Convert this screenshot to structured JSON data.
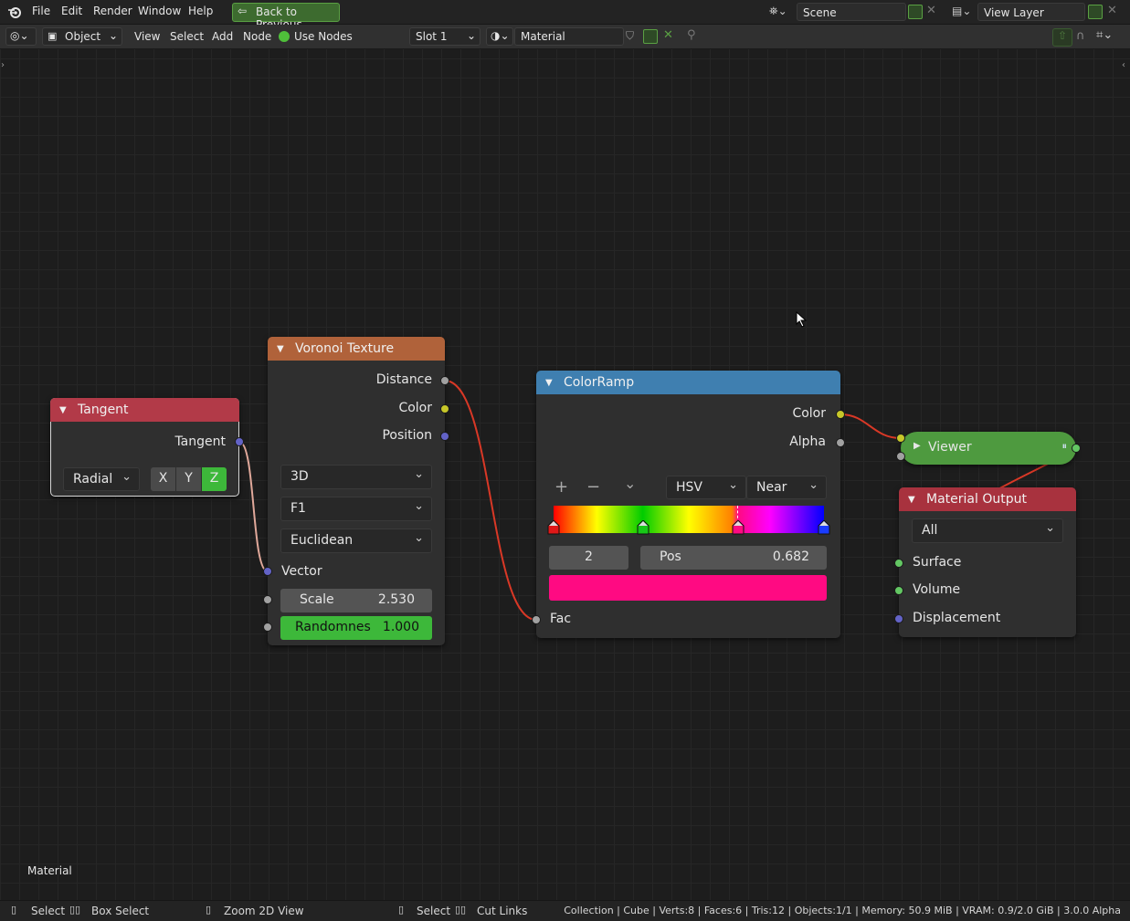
{
  "topbar": {
    "menus": [
      "File",
      "Edit",
      "Render",
      "Window",
      "Help"
    ],
    "back_button": "Back to Previous",
    "scene_field": "Scene",
    "view_layer_field": "View Layer"
  },
  "header": {
    "mode": "Object",
    "menus": [
      "View",
      "Select",
      "Add",
      "Node"
    ],
    "use_nodes": "Use Nodes",
    "slot": "Slot 1",
    "material": "Material"
  },
  "nodes": {
    "tangent": {
      "title": "Tangent",
      "output": "Tangent",
      "direction": "Radial",
      "axes": [
        "X",
        "Y",
        "Z"
      ],
      "active_axis": "Z"
    },
    "voronoi": {
      "title": "Voronoi Texture",
      "outputs": [
        "Distance",
        "Color",
        "Position"
      ],
      "dimension": "3D",
      "feature": "F1",
      "metric": "Euclidean",
      "vector_input": "Vector",
      "scale_label": "Scale",
      "scale_value": "2.530",
      "randomness_label": "Randomnes",
      "randomness_value": "1.000"
    },
    "colorramp": {
      "title": "ColorRamp",
      "outputs": [
        "Color",
        "Alpha"
      ],
      "add_btn": "+",
      "remove_btn": "−",
      "menu_btn": "⌄",
      "color_mode": "HSV",
      "interpolation": "Near",
      "stop_index": "2",
      "pos_label": "Pos",
      "pos_value": "0.682",
      "stops": [
        {
          "pos": 0.0,
          "color": "#e01818"
        },
        {
          "pos": 0.33,
          "color": "#18c818"
        },
        {
          "pos": 0.682,
          "color": "#ff0a82"
        },
        {
          "pos": 1.0,
          "color": "#1a3cff"
        }
      ],
      "active_color": "#ff0a82",
      "fac_input": "Fac"
    },
    "viewer": {
      "title": "Viewer"
    },
    "material_output": {
      "title": "Material Output",
      "target": "All",
      "inputs": [
        "Surface",
        "Volume",
        "Displacement"
      ]
    }
  },
  "canvas_label": "Material",
  "statusbar": {
    "select": "Select",
    "box_select": "Box Select",
    "zoom": "Zoom 2D View",
    "select2": "Select",
    "cut_links": "Cut Links",
    "stats": "Collection | Cube | Verts:8 | Faces:6 | Tris:12 | Objects:1/1 | Memory: 50.9 MiB | VRAM: 0.9/2.0 GiB | 3.0.0 Alpha"
  },
  "colors": {
    "tangent_header": "#b23a48",
    "voronoi_header": "#b0623a",
    "colorramp_header": "#3f7fb0",
    "viewer_body": "#4e9a3f",
    "output_header": "#a8323e",
    "socket_vector": "#6363c7",
    "socket_color": "#c7c729",
    "socket_float": "#a1a1a1",
    "socket_shader": "#63c763",
    "link_red": "#d93826"
  }
}
